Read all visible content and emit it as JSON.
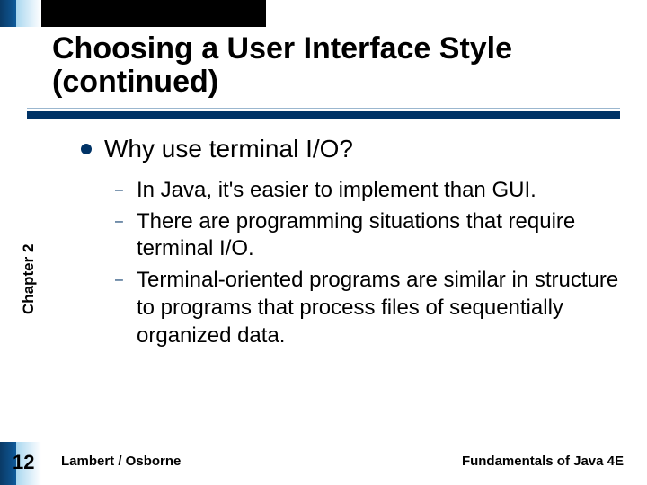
{
  "title": "Choosing a User Interface Style (continued)",
  "chapter_label": "Chapter 2",
  "page_number": "12",
  "footer": {
    "left": "Lambert / Osborne",
    "right": "Fundamentals of Java 4E"
  },
  "content": {
    "heading": "Why use terminal I/O?",
    "sub": [
      "In Java, it's easier to implement than GUI.",
      "There are programming situations that require terminal I/O.",
      "Terminal-oriented programs are similar in structure to programs that process files of sequentially organized data."
    ]
  },
  "colors": {
    "accent": "#003366"
  }
}
